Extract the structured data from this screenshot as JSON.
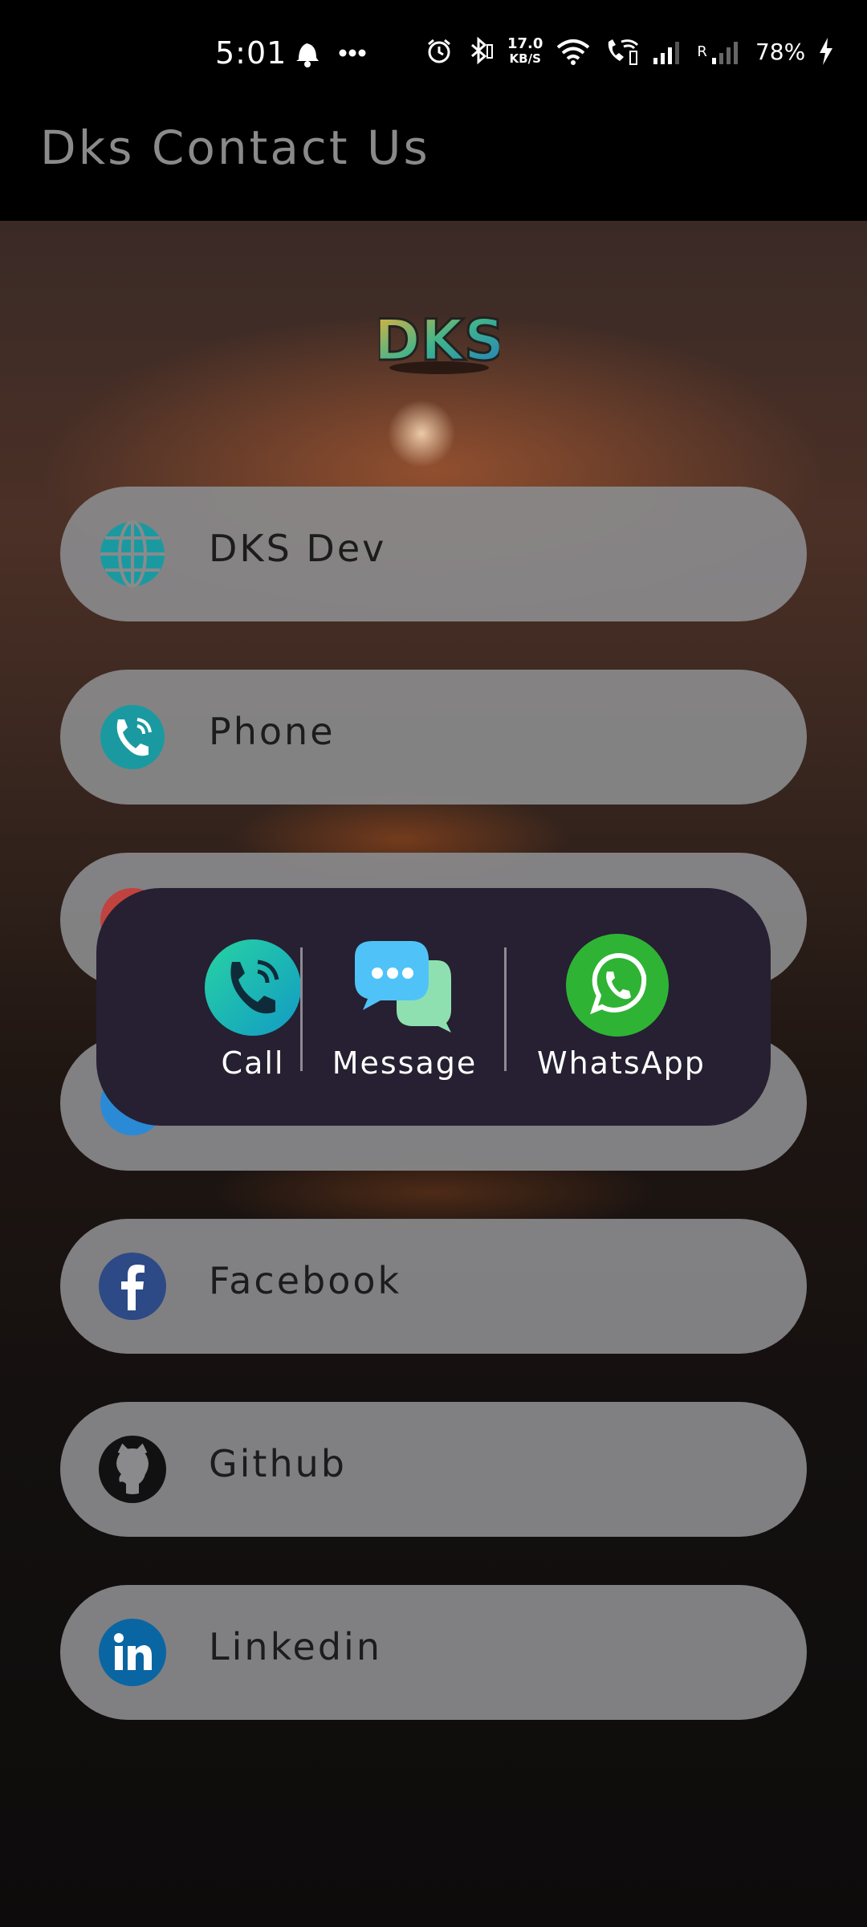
{
  "status_bar": {
    "time": "5:01",
    "network_speed_value": "17.0",
    "network_speed_unit": "KB/S",
    "roaming_label": "R",
    "battery": "78%",
    "icons": [
      "notification-bell-icon",
      "more-dots-icon",
      "alarm-icon",
      "bluetooth-icon",
      "wifi-icon",
      "wifi-calling-icon",
      "signal-icon",
      "signal-roaming-icon",
      "charging-bolt-icon"
    ]
  },
  "app": {
    "title": "Dks Contact Us",
    "logo_text": "DKS"
  },
  "contacts": [
    {
      "label": "DKS Dev",
      "icon": "globe-icon",
      "color": "#1a9aa0"
    },
    {
      "label": "Phone",
      "icon": "phone-icon",
      "color": "#1a9aa0"
    },
    {
      "label": "",
      "icon": "mail-icon",
      "color": "#c0433f"
    },
    {
      "label": "",
      "icon": "telegram-icon",
      "color": "#2b8ad6"
    },
    {
      "label": "Facebook",
      "icon": "facebook-icon",
      "color": "#2d4a86"
    },
    {
      "label": "Github",
      "icon": "github-icon",
      "color": "#111111"
    },
    {
      "label": "Linkedin",
      "icon": "linkedin-icon",
      "color": "#0a66a2"
    }
  ],
  "popup": {
    "options": [
      {
        "label": "Call",
        "icon": "call-icon",
        "color": "#18b8b8"
      },
      {
        "label": "Message",
        "icon": "message-icon",
        "color": "#4fc3f7"
      },
      {
        "label": "WhatsApp",
        "icon": "whatsapp-icon",
        "color": "#2fb335"
      }
    ]
  }
}
